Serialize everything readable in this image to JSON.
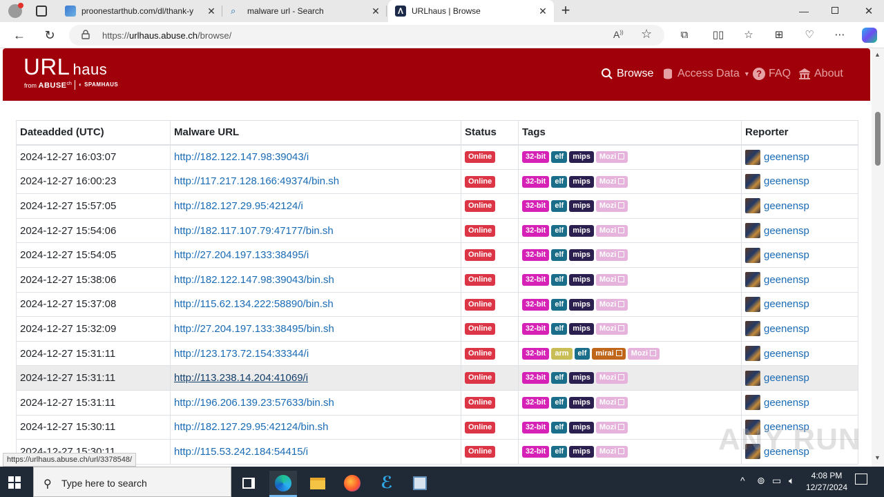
{
  "browser": {
    "tabs": [
      {
        "title": "proonestarthub.com/dl/thank-y",
        "active": false
      },
      {
        "title": "malware url - Search",
        "active": false
      },
      {
        "title": "URLhaus | Browse",
        "active": true
      }
    ],
    "address": {
      "prefix": "https://",
      "host": "urlhaus.abuse.ch",
      "path": "/browse/"
    }
  },
  "site": {
    "logo": {
      "title_main": "URL",
      "title_sub": "haus",
      "from": "from",
      "abuse": "ABUSE",
      "abuse_suffix": "ch",
      "spamhaus": "SPAMHAUS"
    },
    "nav": {
      "browse": "Browse",
      "access": "Access Data",
      "faq": "FAQ",
      "about": "About"
    }
  },
  "table": {
    "headers": {
      "date": "Dateadded (UTC)",
      "url": "Malware URL",
      "status": "Status",
      "tags": "Tags",
      "reporter": "Reporter"
    },
    "rows": [
      {
        "date": "2024-12-27 16:03:07",
        "url": "http://182.122.147.98:39043/i",
        "status": "Online",
        "tags": [
          "32-bit",
          "elf",
          "mips",
          "Mozi"
        ],
        "reporter": "geenensp"
      },
      {
        "date": "2024-12-27 16:00:23",
        "url": "http://117.217.128.166:49374/bin.sh",
        "status": "Online",
        "tags": [
          "32-bit",
          "elf",
          "mips",
          "Mozi"
        ],
        "reporter": "geenensp"
      },
      {
        "date": "2024-12-27 15:57:05",
        "url": "http://182.127.29.95:42124/i",
        "status": "Online",
        "tags": [
          "32-bit",
          "elf",
          "mips",
          "Mozi"
        ],
        "reporter": "geenensp"
      },
      {
        "date": "2024-12-27 15:54:06",
        "url": "http://182.117.107.79:47177/bin.sh",
        "status": "Online",
        "tags": [
          "32-bit",
          "elf",
          "mips",
          "Mozi"
        ],
        "reporter": "geenensp"
      },
      {
        "date": "2024-12-27 15:54:05",
        "url": "http://27.204.197.133:38495/i",
        "status": "Online",
        "tags": [
          "32-bit",
          "elf",
          "mips",
          "Mozi"
        ],
        "reporter": "geenensp"
      },
      {
        "date": "2024-12-27 15:38:06",
        "url": "http://182.122.147.98:39043/bin.sh",
        "status": "Online",
        "tags": [
          "32-bit",
          "elf",
          "mips",
          "Mozi"
        ],
        "reporter": "geenensp"
      },
      {
        "date": "2024-12-27 15:37:08",
        "url": "http://115.62.134.222:58890/bin.sh",
        "status": "Online",
        "tags": [
          "32-bit",
          "elf",
          "mips",
          "Mozi"
        ],
        "reporter": "geenensp"
      },
      {
        "date": "2024-12-27 15:32:09",
        "url": "http://27.204.197.133:38495/bin.sh",
        "status": "Online",
        "tags": [
          "32-bit",
          "elf",
          "mips",
          "Mozi"
        ],
        "reporter": "geenensp"
      },
      {
        "date": "2024-12-27 15:31:11",
        "url": "http://123.173.72.154:33344/i",
        "status": "Online",
        "tags": [
          "32-bit",
          "arm",
          "elf",
          "mirai",
          "Mozi"
        ],
        "reporter": "geenensp"
      },
      {
        "date": "2024-12-27 15:31:11",
        "url": "http://113.238.14.204:41069/i",
        "status": "Online",
        "tags": [
          "32-bit",
          "elf",
          "mips",
          "Mozi"
        ],
        "reporter": "geenensp",
        "hover": true
      },
      {
        "date": "2024-12-27 15:31:11",
        "url": "http://196.206.139.23:57633/bin.sh",
        "status": "Online",
        "tags": [
          "32-bit",
          "elf",
          "mips",
          "Mozi"
        ],
        "reporter": "geenensp"
      },
      {
        "date": "2024-12-27 15:30:11",
        "url": "http://182.127.29.95:42124/bin.sh",
        "status": "Online",
        "tags": [
          "32-bit",
          "elf",
          "mips",
          "Mozi"
        ],
        "reporter": "geenensp"
      },
      {
        "date": "2024-12-27 15:30:11",
        "url": "http://115.53.242.184:54415/i",
        "status": "Online",
        "tags": [
          "32-bit",
          "elf",
          "mips",
          "Mozi"
        ],
        "reporter": "geenensp"
      }
    ]
  },
  "tag_colors": {
    "32-bit": "#d621b6",
    "elf": "#1a6e8a",
    "mips": "#2b1f4f",
    "Mozi": "#e6b3dc",
    "arm": "#c9bd55",
    "mirai": "#c0661a"
  },
  "tag_links": [
    "Mozi",
    "mirai"
  ],
  "status_color": "#dc3545",
  "statusbar": {
    "link": "https://urlhaus.abuse.ch/url/3378548/"
  },
  "watermark": "ANY RUN",
  "taskbar": {
    "search_placeholder": "Type here to search",
    "time": "4:08 PM",
    "date": "12/27/2024"
  }
}
